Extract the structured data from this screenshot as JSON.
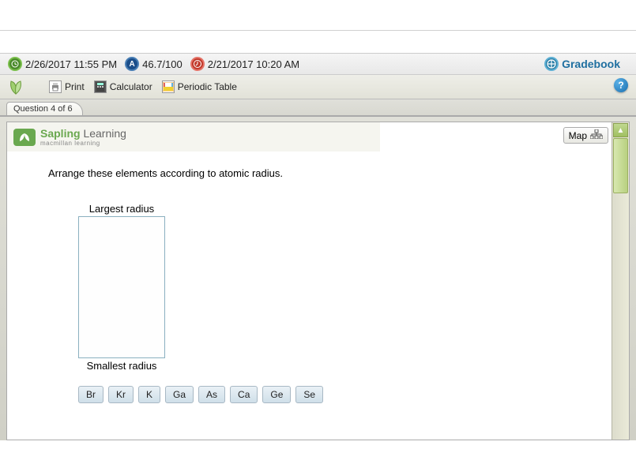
{
  "info": {
    "due_date": "2/26/2017 11:55 PM",
    "score": "46.7/100",
    "start_date": "2/21/2017 10:20 AM",
    "gradebook": "Gradebook"
  },
  "toolbar": {
    "print": "Print",
    "calculator": "Calculator",
    "periodic_table": "Periodic Table"
  },
  "tab": {
    "label": "Question 4 of 6"
  },
  "brand": {
    "name1": "Sapling",
    "name2": " Learning",
    "sub": "macmillan learning"
  },
  "map_btn": "Map",
  "question": {
    "prompt": "Arrange these elements according to atomic radius.",
    "top_label": "Largest radius",
    "bottom_label": "Smallest radius",
    "elements": [
      "Br",
      "Kr",
      "K",
      "Ga",
      "As",
      "Ca",
      "Ge",
      "Se"
    ]
  }
}
